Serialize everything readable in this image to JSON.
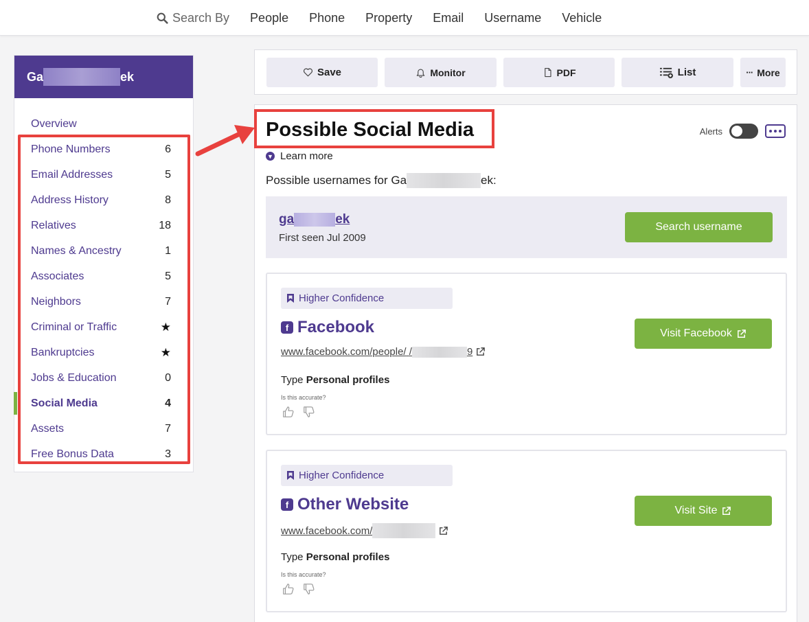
{
  "topnav": {
    "search_by": "Search By",
    "links": [
      "People",
      "Phone",
      "Property",
      "Email",
      "Username",
      "Vehicle"
    ]
  },
  "sidebar": {
    "person_name_start": "Ga",
    "person_name_end": "ek",
    "items": [
      {
        "label": "Overview",
        "count": ""
      },
      {
        "label": "Phone Numbers",
        "count": "6"
      },
      {
        "label": "Email Addresses",
        "count": "5"
      },
      {
        "label": "Address History",
        "count": "8"
      },
      {
        "label": "Relatives",
        "count": "18"
      },
      {
        "label": "Names & Ancestry",
        "count": "1"
      },
      {
        "label": "Associates",
        "count": "5"
      },
      {
        "label": "Neighbors",
        "count": "7"
      },
      {
        "label": "Criminal or Traffic",
        "count": "★"
      },
      {
        "label": "Bankruptcies",
        "count": "★"
      },
      {
        "label": "Jobs & Education",
        "count": "0"
      },
      {
        "label": "Social Media",
        "count": "4"
      },
      {
        "label": "Assets",
        "count": "7"
      },
      {
        "label": "Free Bonus Data",
        "count": "3"
      }
    ],
    "active_item": "Social Media"
  },
  "toolbar": {
    "save": "Save",
    "monitor": "Monitor",
    "pdf": "PDF",
    "list": "List",
    "more": "More"
  },
  "section": {
    "title": "Possible Social Media",
    "alerts_label": "Alerts",
    "alerts_on": false,
    "learn_more": "Learn more",
    "usernames_prefix": "Possible usernames for Ga",
    "usernames_suffix": "ek:"
  },
  "username_result": {
    "name_start": "ga",
    "name_end": "ek",
    "first_seen": "First seen Jul 2009",
    "button": "Search username"
  },
  "results": [
    {
      "confidence": "Higher Confidence",
      "site": "Facebook",
      "url_start": "www.facebook.com/people/",
      "url_mid": "/",
      "url_end": "9",
      "type_label": "Type",
      "type_value": "Personal profiles",
      "accurate_q": "Is this accurate?",
      "button": "Visit Facebook"
    },
    {
      "confidence": "Higher Confidence",
      "site": "Other Website",
      "url_start": "www.facebook.com/",
      "url_mid": "",
      "url_end": "",
      "type_label": "Type",
      "type_value": "Personal profiles",
      "accurate_q": "Is this accurate?",
      "button": "Visit Site"
    }
  ],
  "colors": {
    "brand_purple": "#4e3a8f",
    "accent_green": "#7cb342",
    "highlight_red": "#e8413e"
  }
}
